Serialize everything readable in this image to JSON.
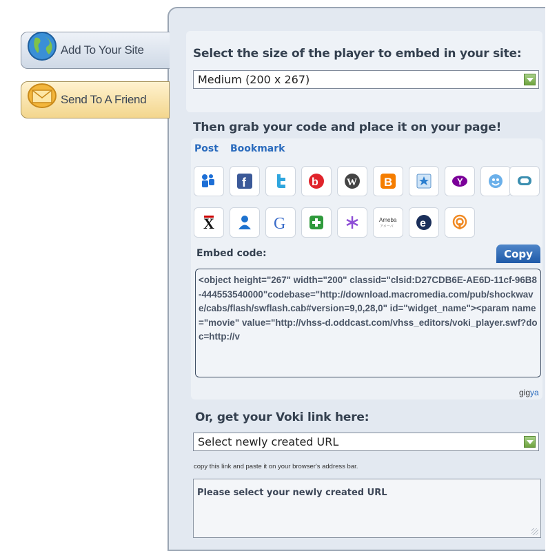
{
  "tabs": {
    "add": {
      "label": "Add To Your Site",
      "icon": "globe-icon"
    },
    "send": {
      "label": "Send To A Friend",
      "icon": "envelope-icon"
    }
  },
  "size_section": {
    "heading": "Select the size of the player to embed in your site:",
    "selected": "Medium (200 x 267)"
  },
  "code_section": {
    "heading": "Then grab your code and place it on your page!",
    "tabs": [
      "Post",
      "Bookmark"
    ],
    "services_row1": [
      "myspace-icon",
      "facebook-icon",
      "twitter-icon",
      "bebo-icon",
      "wordpress-icon",
      "blogger-icon",
      "favorites-icon",
      "yahoo-icon",
      "live-spaces-icon",
      "comment-icon"
    ],
    "services_row2": [
      "xanga-icon",
      "profile-icon",
      "google-icon",
      "plus-icon",
      "asterisk-icon",
      "ameba-icon",
      "e-icon",
      "rss-icon"
    ],
    "embed_label": "Embed code:",
    "copy_label": "Copy",
    "embed_code": "<object height=\"267\" width=\"200\" classid=\"clsid:D27CDB6E-AE6D-11cf-96B8-444553540000\"codebase=\"http://download.macromedia.com/pub/shockwave/cabs/flash/swflash.cab#version=9,0,28,0\" id=\"widget_name\"><param name=\"movie\" value=\"http://vhss-d.oddcast.com/vhss_editors/voki_player.swf?doc=http://v",
    "brand_gig": "gig",
    "brand_ya": "ya"
  },
  "link_section": {
    "heading": "Or, get your Voki link here:",
    "selected": "Select newly created URL",
    "hint": "copy this link and paste it on your browser's address bar.",
    "url_text": "Please select your newly created URL"
  },
  "colors": {
    "accent": "#2a6bbd",
    "copy_button": "#2862ad",
    "panel": "#e3e9f1"
  }
}
